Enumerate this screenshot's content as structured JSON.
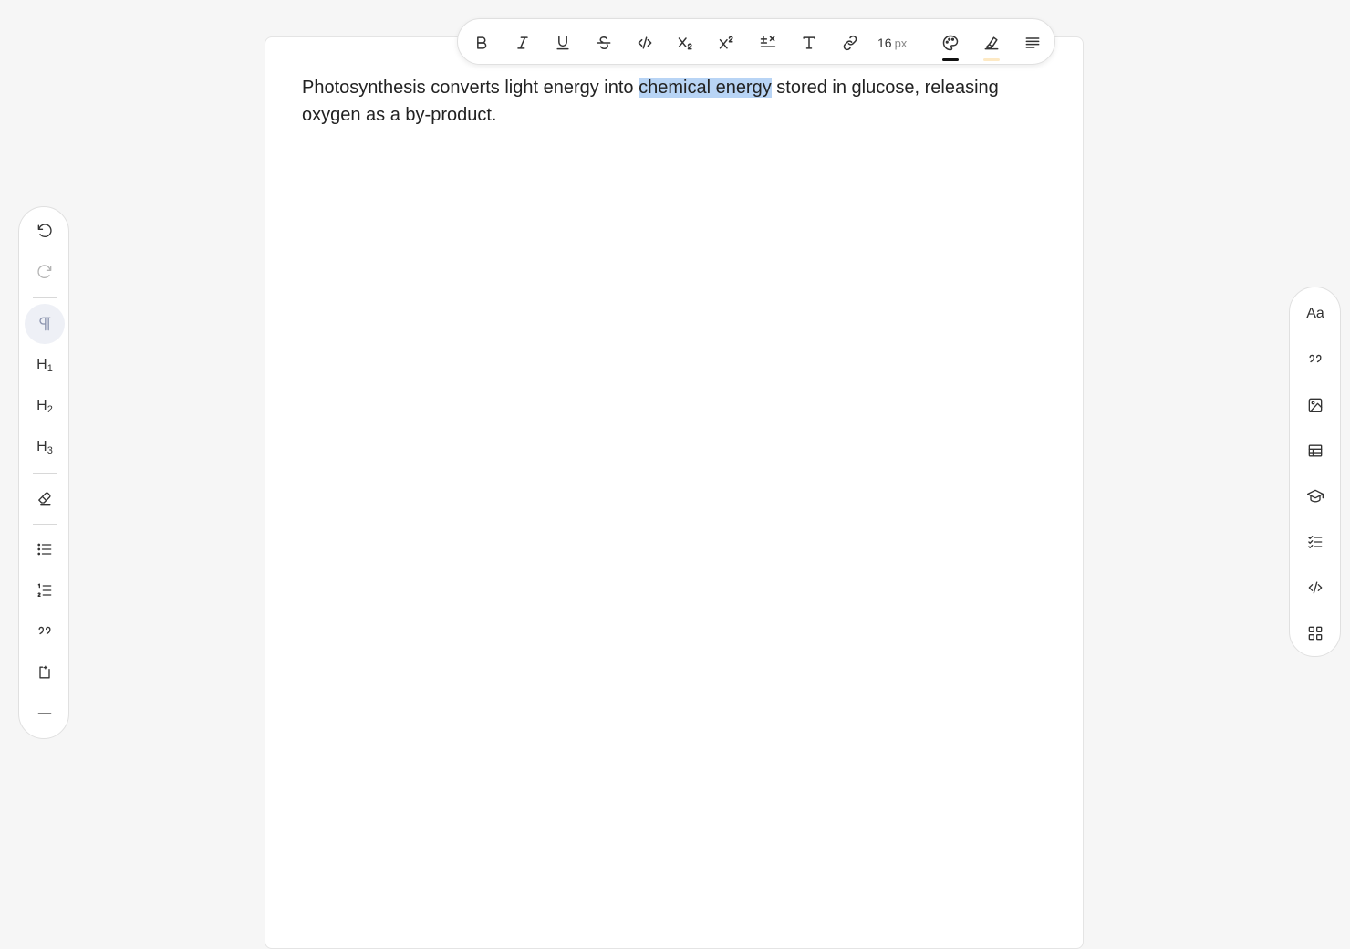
{
  "document": {
    "text_before": "Photosynthesis converts light energy into ",
    "text_selected": "chemical energy",
    "text_after": " stored in glucose, releasing oxygen as a by-product."
  },
  "toolbar": {
    "font_size_value": "16",
    "font_size_unit": "px",
    "text_color": "#111111",
    "highlight_color": "#fde9c4"
  },
  "left_rail": {
    "h1_letter": "H",
    "h1_num": "1",
    "h2_letter": "H",
    "h2_num": "2",
    "h3_letter": "H",
    "h3_num": "3"
  },
  "right_rail": {
    "typography_label": "Aa"
  },
  "colors": {
    "selection": "#b8d4f5",
    "active_bg": "#eef0f6"
  }
}
